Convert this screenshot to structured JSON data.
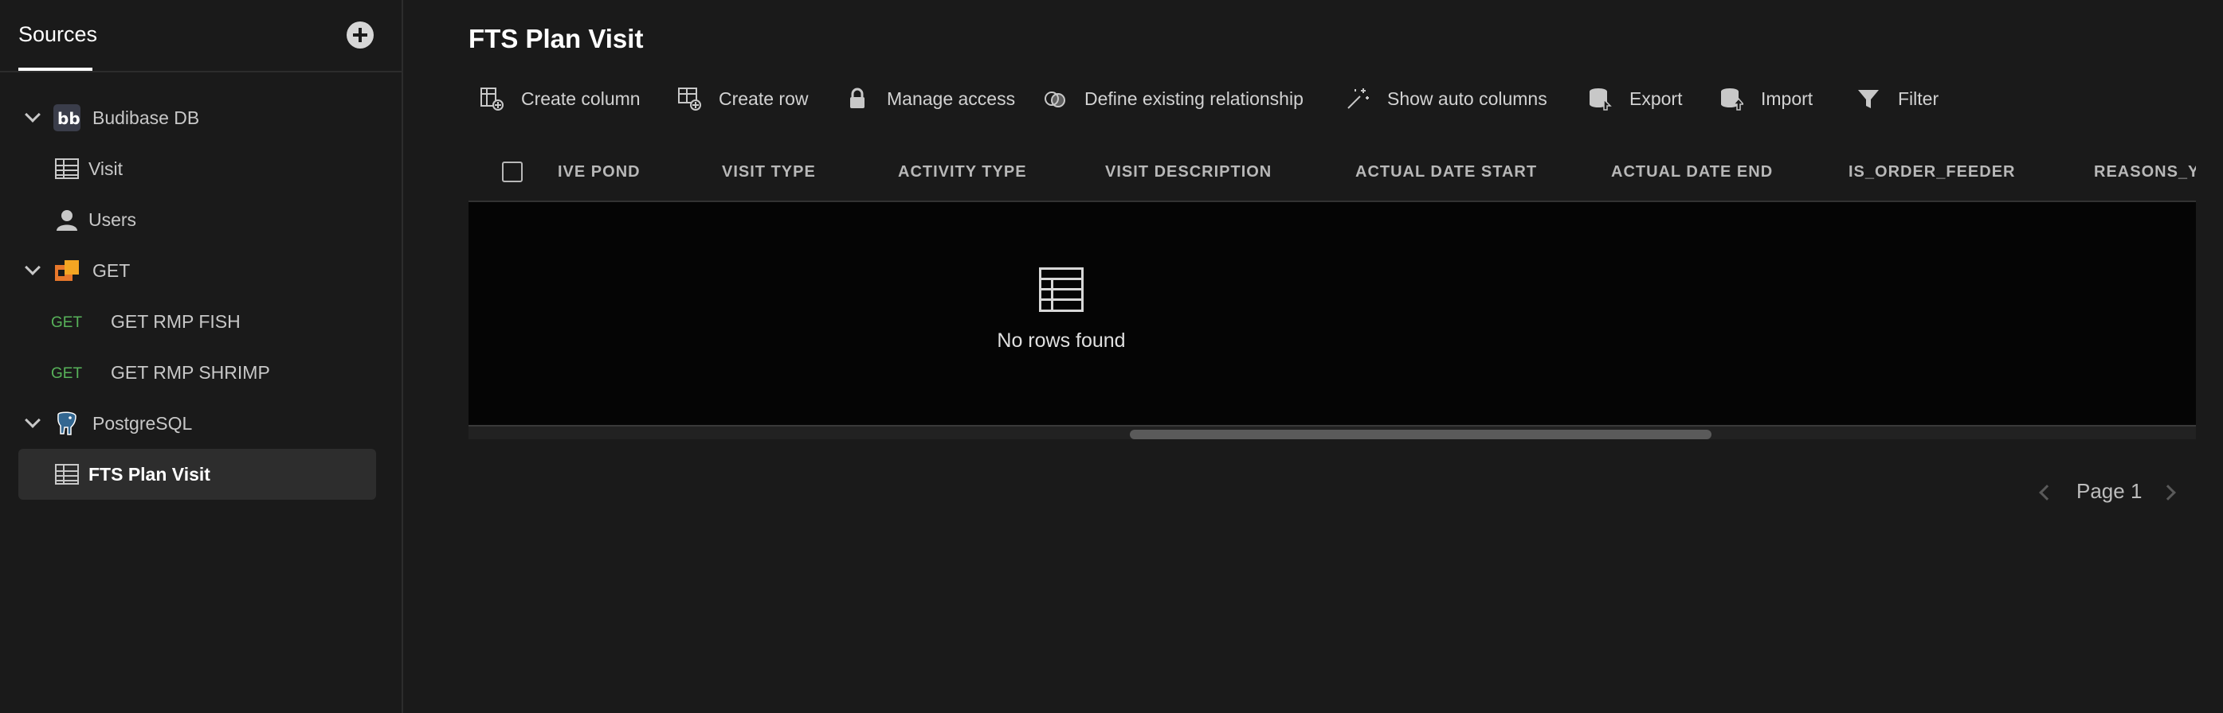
{
  "sidebar": {
    "title": "Sources",
    "datasources": [
      {
        "label": "Budibase DB",
        "icon": "budibase-logo-icon",
        "tables": [
          "Visit",
          "Users"
        ]
      },
      {
        "label": "GET",
        "icon": "rest-api-icon",
        "queries": [
          {
            "method": "GET",
            "label": "GET RMP FISH"
          },
          {
            "method": "GET",
            "label": "GET RMP SHRIMP"
          }
        ]
      },
      {
        "label": "PostgreSQL",
        "icon": "postgresql-elephant-icon",
        "tables": [
          "FTS Plan Visit"
        ]
      }
    ]
  },
  "main": {
    "title": "FTS Plan Visit",
    "toolbar": {
      "create_column": "Create column",
      "create_row": "Create row",
      "manage_access": "Manage access",
      "define_relationship": "Define existing relationship",
      "show_auto_columns": "Show auto columns",
      "export": "Export",
      "import": "Import",
      "filter": "Filter"
    },
    "columns": [
      "IVE POND",
      "VISIT TYPE",
      "ACTIVITY TYPE",
      "VISIT DESCRIPTION",
      "ACTUAL DATE START",
      "ACTUAL DATE END",
      "IS_ORDER_FEEDER",
      "REASONS_Y"
    ],
    "empty_message": "No rows found",
    "pager": "Page 1"
  },
  "colors": {
    "background": "#1a1a1a",
    "grid_body": "#050505",
    "selected": "#2d2d2d",
    "get_method": "#58b35a",
    "budibase_icon": "#3a3d4a",
    "rest_icon": "#e8782b",
    "postgres_icon": "#336791"
  }
}
